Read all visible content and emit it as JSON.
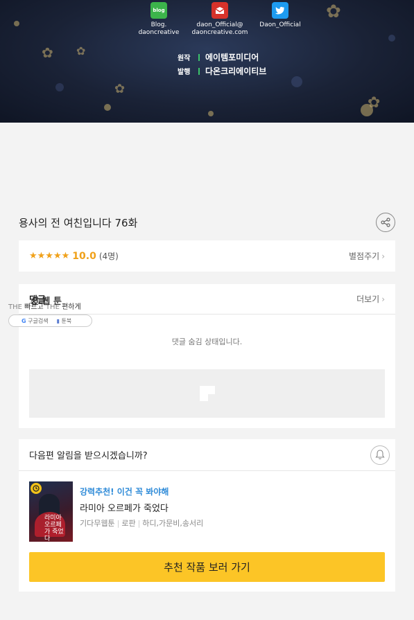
{
  "banner": {
    "socials": [
      {
        "icon": "blog-icon",
        "line1": "Blog.",
        "line2": "daoncreative",
        "color": "#3cb44b"
      },
      {
        "icon": "mail-icon",
        "line1": "daon_Official@",
        "line2": "daoncreative.com",
        "color": "#d6322a"
      },
      {
        "icon": "twitter-icon",
        "line1": "Daon_Official",
        "line2": "",
        "color": "#1d9bf0"
      }
    ],
    "blog_badge": "blog",
    "credits": [
      {
        "key": "원작",
        "value": "에이템포미디어"
      },
      {
        "key": "발행",
        "value": "다온크리에이티브"
      }
    ]
  },
  "episode": {
    "title": "용사의 전 여친입니다 76화"
  },
  "rating": {
    "stars": "★★★★★",
    "score": "10.0",
    "count": "(4명)",
    "action": "별점주기"
  },
  "comments": {
    "label": "댓글",
    "more": "더보기",
    "hidden_message": "댓글 숨김 상태입니다."
  },
  "overlay": {
    "title": "신 웹 툰",
    "line_prefix": "THE",
    "line_a": "빠르고",
    "line_b": "THE",
    "line_c": "편하게",
    "google": "구글검색",
    "toonbook": "툰북"
  },
  "notify": {
    "question": "다음편 알림을 받으시겠습니까?",
    "recommend_badge": "강력추천! 이건 꼭 봐야해",
    "recommend_title": "라미아 오르페가 죽었다",
    "meta": [
      "기다무웹툰",
      "로판",
      "하디,가문비,송서리"
    ],
    "thumb_text": "라미아 오르페가 죽었다",
    "cta": "추천 작품 보러 가기"
  }
}
